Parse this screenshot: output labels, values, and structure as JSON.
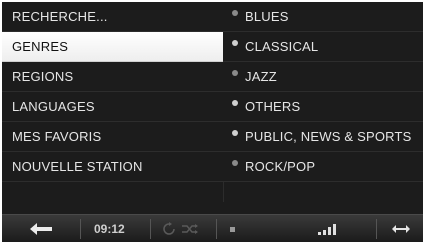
{
  "left_menu": {
    "items": [
      {
        "label": "RECHERCHE..."
      },
      {
        "label": "GENRES"
      },
      {
        "label": "REGIONS"
      },
      {
        "label": "LANGUAGES"
      },
      {
        "label": "MES FAVORIS"
      },
      {
        "label": "NOUVELLE STATION"
      }
    ],
    "selected_index": 1
  },
  "right_menu": {
    "items": [
      {
        "label": "BLUES"
      },
      {
        "label": "CLASSICAL"
      },
      {
        "label": "JAZZ"
      },
      {
        "label": "OTHERS"
      },
      {
        "label": "PUBLIC, NEWS & SPORTS"
      },
      {
        "label": "ROCK/POP"
      }
    ]
  },
  "status_bar": {
    "time": "09:12",
    "icons": [
      "back-arrow-icon",
      "repeat-icon",
      "shuffle-icon",
      "stop-icon",
      "signal-strength-icon",
      "expand-arrows-icon"
    ]
  },
  "colors": {
    "background": "#1c1c1c",
    "selected_row": "#ffffff",
    "text": "#e6e6e6"
  }
}
